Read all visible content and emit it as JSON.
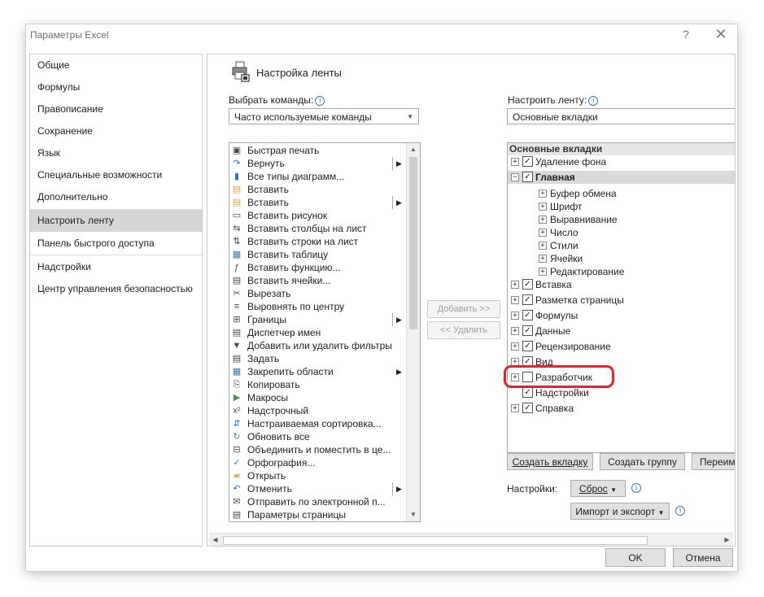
{
  "window": {
    "title": "Параметры Excel",
    "help": "?",
    "close": "✕"
  },
  "nav": {
    "items": [
      "Общие",
      "Формулы",
      "Правописание",
      "Сохранение",
      "Язык",
      "Специальные возможности",
      "Дополнительно",
      "Настроить ленту",
      "Панель быстрого доступа",
      "Надстройки",
      "Центр управления безопасностью"
    ],
    "selected": "Настроить ленту"
  },
  "main": {
    "heading": "Настройка ленты",
    "choose_label": "Выбрать команды:",
    "choose_value": "Часто используемые команды",
    "customize_label": "Настроить ленту:",
    "customize_value": "Основные вкладки",
    "commands": [
      "Быстрая печать",
      "Вернуть",
      "Все типы диаграмм...",
      "Вставить",
      "Вставить",
      "Вставить рисунок",
      "Вставить столбцы на лист",
      "Вставить строки на лист",
      "Вставить таблицу",
      "Вставить функцию...",
      "Вставить ячейки...",
      "Вырезать",
      "Выровнять по центру",
      "Границы",
      "Диспетчер имен",
      "Добавить или удалить фильтры",
      "Задать",
      "Закрепить области",
      "Копировать",
      "Макросы",
      "Надстрочный",
      "Настраиваемая сортировка...",
      "Обновить все",
      "Объединить и поместить в це...",
      "Орфография...",
      "Открыть",
      "Отменить",
      "Отправить по электронной п...",
      "Параметры страницы"
    ],
    "add_button": "Добавить >>",
    "remove_button": "<< Удалить",
    "tree": {
      "header": "Основные вкладки",
      "rows": [
        {
          "label": "Удаление фона",
          "checked": true,
          "expand": "+"
        },
        {
          "label": "Главная",
          "checked": true,
          "expand": "−"
        },
        {
          "label": "Буфер обмена",
          "expand": "+"
        },
        {
          "label": "Шрифт",
          "expand": "+"
        },
        {
          "label": "Выравнивание",
          "expand": "+"
        },
        {
          "label": "Число",
          "expand": "+"
        },
        {
          "label": "Стили",
          "expand": "+"
        },
        {
          "label": "Ячейки",
          "expand": "+"
        },
        {
          "label": "Редактирование",
          "expand": "+"
        },
        {
          "label": "Вставка",
          "checked": true,
          "expand": "+"
        },
        {
          "label": "Разметка страницы",
          "checked": true,
          "expand": "+"
        },
        {
          "label": "Формулы",
          "checked": true,
          "expand": "+"
        },
        {
          "label": "Данные",
          "checked": true,
          "expand": "+"
        },
        {
          "label": "Рецензирование",
          "checked": true,
          "expand": "+"
        },
        {
          "label": "Вид",
          "checked": true,
          "expand": "+"
        },
        {
          "label": "Разработчик",
          "checked": false,
          "expand": "+"
        },
        {
          "label": "Надстройки",
          "checked": true,
          "expand": ""
        },
        {
          "label": "Справка",
          "checked": true,
          "expand": "+"
        }
      ]
    },
    "new_tab_button": "Создать вкладку",
    "new_group_button": "Создать группу",
    "rename_button": "Переим",
    "settings_label": "Настройки:",
    "reset_button": "Сброс",
    "import_export_button": "Импорт и экспорт"
  },
  "footer": {
    "ok": "OK",
    "cancel": "Отмена"
  },
  "colors": {
    "highlight": "#e5242b",
    "selected_nav": "#d6d6d6",
    "info_icon": "#2f78c7"
  }
}
